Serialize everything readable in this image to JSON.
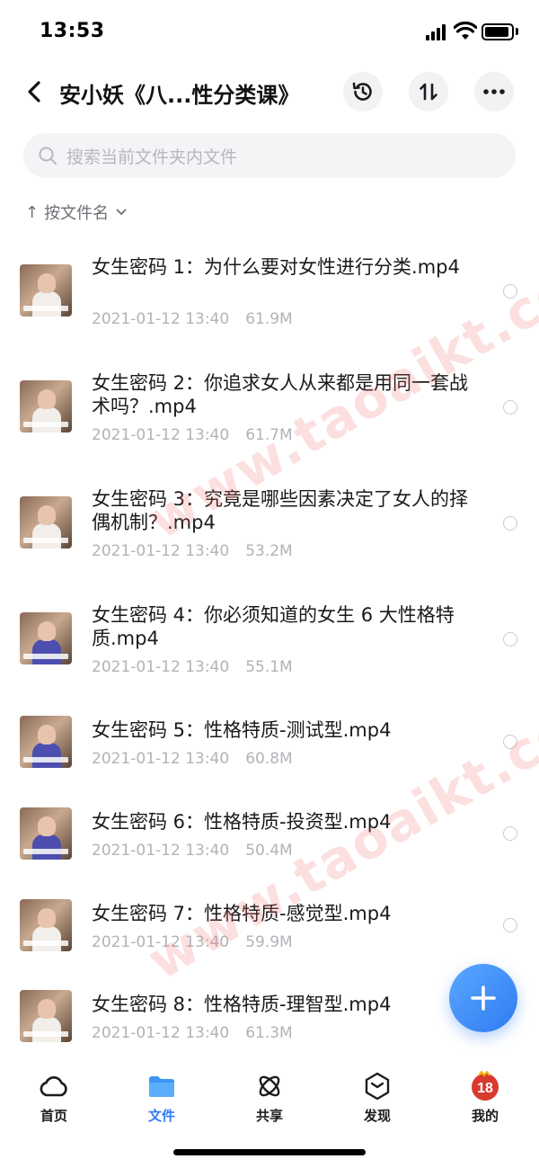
{
  "status_bar": {
    "time": "13:53"
  },
  "header": {
    "title": "安小妖《八...性分类课》"
  },
  "search": {
    "placeholder": "搜索当前文件夹内文件"
  },
  "sort": {
    "label": "按文件名",
    "arrow": "↑"
  },
  "files": [
    {
      "name": "女生密码 1：为什么要对女性进行分类.mp4",
      "date": "2021-01-12 13:40",
      "size": "61.9M"
    },
    {
      "name": "女生密码 2：你追求女人从来都是用同一套战术吗？.mp4",
      "date": "2021-01-12 13:40",
      "size": "61.7M"
    },
    {
      "name": "女生密码 3：究竟是哪些因素决定了女人的择偶机制？.mp4",
      "date": "2021-01-12 13:40",
      "size": "53.2M"
    },
    {
      "name": "女生密码 4：你必须知道的女生 6 大性格特质.mp4",
      "date": "2021-01-12 13:40",
      "size": "55.1M"
    },
    {
      "name": "女生密码 5：性格特质-测试型.mp4",
      "date": "2021-01-12 13:40",
      "size": "60.8M"
    },
    {
      "name": "女生密码 6：性格特质-投资型.mp4",
      "date": "2021-01-12 13:40",
      "size": "50.4M"
    },
    {
      "name": "女生密码 7：性格特质-感觉型.mp4",
      "date": "2021-01-12 13:40",
      "size": "59.9M"
    },
    {
      "name": "女生密码 8：性格特质-理智型.mp4",
      "date": "2021-01-12 13:40",
      "size": "61.3M"
    }
  ],
  "watermark": "www.taoaikt.com",
  "tabs": [
    {
      "label": "首页",
      "icon": "cloud-icon"
    },
    {
      "label": "文件",
      "icon": "folder-icon"
    },
    {
      "label": "共享",
      "icon": "atom-icon"
    },
    {
      "label": "发现",
      "icon": "cube-icon"
    },
    {
      "label": "我的",
      "icon": "avatar-icon"
    }
  ],
  "profile_badge": "18",
  "colors": {
    "accent": "#2f7bf2",
    "watermark": "#f06e6e"
  }
}
